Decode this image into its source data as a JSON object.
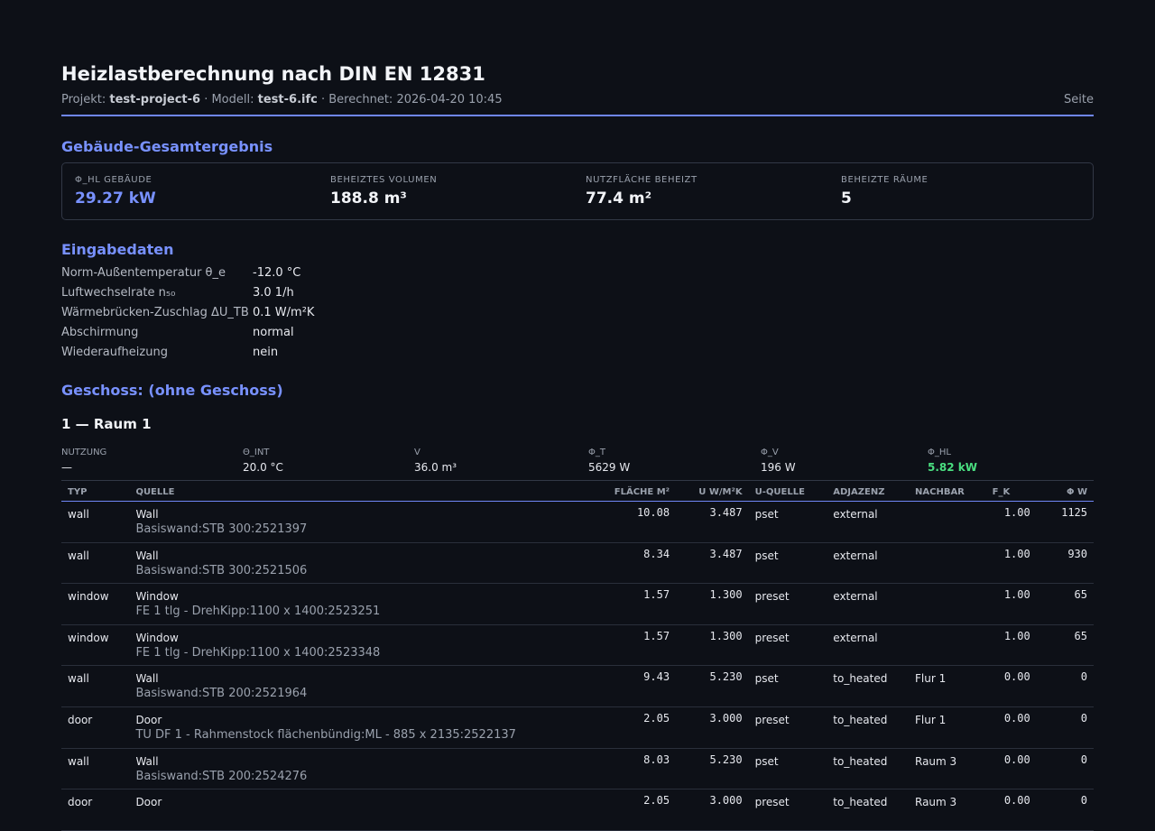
{
  "header": {
    "title": "Heizlastberechnung nach DIN EN 12831",
    "project_label": "Projekt:",
    "project_value": "test-project-6",
    "model_label": "· Modell:",
    "model_value": "test-6.ifc",
    "calc_label": "· Berechnet: 2026-04-20 10:45",
    "page_label": "Seite"
  },
  "summary": {
    "title": "Gebäude-Gesamtergebnis",
    "cells": [
      {
        "label": "Φ_HL Gebäude",
        "value": "29.27 kW"
      },
      {
        "label": "Beheiztes Volumen",
        "value": "188.8 m³"
      },
      {
        "label": "Nutzfläche beheizt",
        "value": "77.4 m²"
      },
      {
        "label": "Beheizte Räume",
        "value": "5"
      }
    ]
  },
  "inputs": {
    "title": "Eingabedaten",
    "rows": [
      {
        "key": "Norm-Außentemperatur θ_e",
        "value": "-12.0 °C"
      },
      {
        "key": "Luftwechselrate n₅₀",
        "value": "3.0 1/h"
      },
      {
        "key": "Wärmebrücken-Zuschlag ΔU_TB",
        "value": "0.1 W/m²K"
      },
      {
        "key": "Abschirmung",
        "value": "normal"
      },
      {
        "key": "Wiederaufheizung",
        "value": "nein"
      }
    ]
  },
  "storey": {
    "title": "Geschoss: (ohne Geschoss)",
    "room": {
      "title": "1 — Raum 1",
      "stats": [
        {
          "label": "Nutzung",
          "value": "—"
        },
        {
          "label": "Θ_int",
          "value": "20.0 °C"
        },
        {
          "label": "V",
          "value": "36.0 m³"
        },
        {
          "label": "Φ_T",
          "value": "5629 W"
        },
        {
          "label": "Φ_V",
          "value": "196 W"
        },
        {
          "label": "Φ_HL",
          "value": "5.82 kW"
        }
      ],
      "columns": [
        "Typ",
        "Quelle",
        "Fläche m²",
        "U W/m²K",
        "U-Quelle",
        "Adjazenz",
        "Nachbar",
        "f_k",
        "Φ W"
      ],
      "rows": [
        {
          "typ": "wall",
          "q1": "Wall",
          "q2": "Basiswand:STB 300:2521397",
          "area": "10.08",
          "u": "3.487",
          "usrc": "pset",
          "adj": "external",
          "nb": "",
          "fk": "1.00",
          "phi": "1125"
        },
        {
          "typ": "wall",
          "q1": "Wall",
          "q2": "Basiswand:STB 300:2521506",
          "area": "8.34",
          "u": "3.487",
          "usrc": "pset",
          "adj": "external",
          "nb": "",
          "fk": "1.00",
          "phi": "930"
        },
        {
          "typ": "window",
          "q1": "Window",
          "q2": "FE 1 tlg - DrehKipp:1100 x 1400:2523251",
          "area": "1.57",
          "u": "1.300",
          "usrc": "preset",
          "adj": "external",
          "nb": "",
          "fk": "1.00",
          "phi": "65"
        },
        {
          "typ": "window",
          "q1": "Window",
          "q2": "FE 1 tlg - DrehKipp:1100 x 1400:2523348",
          "area": "1.57",
          "u": "1.300",
          "usrc": "preset",
          "adj": "external",
          "nb": "",
          "fk": "1.00",
          "phi": "65"
        },
        {
          "typ": "wall",
          "q1": "Wall",
          "q2": "Basiswand:STB 200:2521964",
          "area": "9.43",
          "u": "5.230",
          "usrc": "pset",
          "adj": "to_heated",
          "nb": "Flur 1",
          "fk": "0.00",
          "phi": "0"
        },
        {
          "typ": "door",
          "q1": "Door",
          "q2": "TU DF 1 - Rahmenstock flächenbündig:ML - 885 x 2135:2522137",
          "area": "2.05",
          "u": "3.000",
          "usrc": "preset",
          "adj": "to_heated",
          "nb": "Flur 1",
          "fk": "0.00",
          "phi": "0"
        },
        {
          "typ": "wall",
          "q1": "Wall",
          "q2": "Basiswand:STB 200:2524276",
          "area": "8.03",
          "u": "5.230",
          "usrc": "pset",
          "adj": "to_heated",
          "nb": "Raum 3",
          "fk": "0.00",
          "phi": "0"
        },
        {
          "typ": "door",
          "q1": "Door",
          "q2": "",
          "area": "2.05",
          "u": "3.000",
          "usrc": "preset",
          "adj": "to_heated",
          "nb": "Raum 3",
          "fk": "0.00",
          "phi": "0"
        }
      ]
    }
  }
}
